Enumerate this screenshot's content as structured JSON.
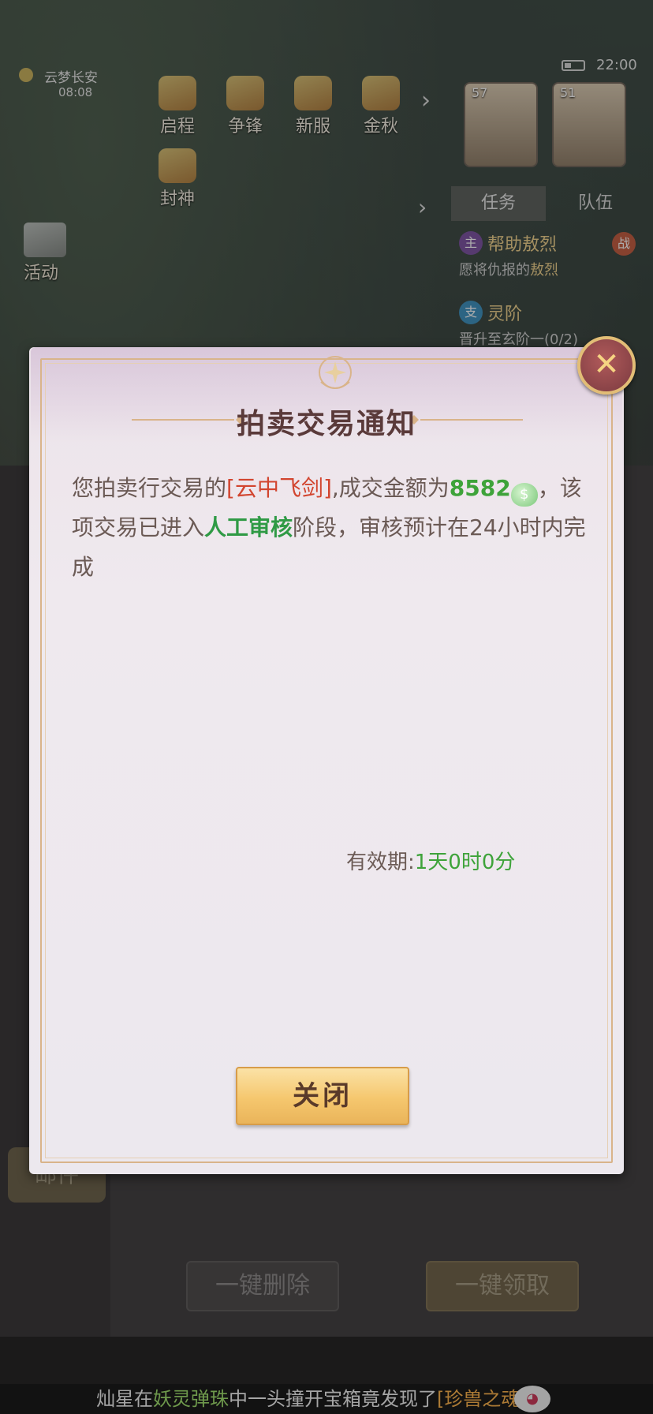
{
  "status_bar": {
    "time": "22:00"
  },
  "location": {
    "name": "云梦长安",
    "time": "08:08"
  },
  "top_menu": [
    {
      "label": "启程",
      "icon": "scroll-icon"
    },
    {
      "label": "争锋",
      "icon": "banner-icon"
    },
    {
      "label": "新服",
      "icon": "firework-icon"
    },
    {
      "label": "金秋",
      "icon": "character-icon"
    }
  ],
  "feng_shen": {
    "label": "封神"
  },
  "side_menu": {
    "activity": "活动"
  },
  "portraits": [
    {
      "level": "57"
    },
    {
      "level": "51"
    }
  ],
  "tracker": {
    "tab_task": "任务",
    "tab_team": "队伍",
    "quests": [
      {
        "tag": "主",
        "title": "帮助敖烈",
        "desc_prefix": "愿将仇报的",
        "desc_highlight": "敖烈",
        "badge": "战"
      },
      {
        "tag": "支",
        "title": "灵阶",
        "desc": "晋升至玄阶一(0/2)"
      }
    ]
  },
  "mail_panel": {
    "mail_button": "邮件",
    "delete_all": "一键删除",
    "claim_all": "一键领取"
  },
  "ticker": {
    "player": "灿星",
    "in": "在",
    "game": "妖灵弹珠",
    "mid": "中一头撞开宝箱竟发现了",
    "item": "[珍兽之魂]"
  },
  "dialog": {
    "title": "拍卖交易通知",
    "body_p1": "您拍卖行交易的",
    "item_name": "[云中飞剑]",
    "body_p2": ",成交金额为",
    "amount": "8582",
    "coin_glyph": "$",
    "body_p3": "，该项交易已进入",
    "review_stage": "人工审核",
    "body_p4": "阶段，审核预计在24小时内完成",
    "validity_label": "有效期:",
    "validity_value": "1天0时0分",
    "close_label": "关闭",
    "close_x": "✕"
  },
  "colors": {
    "accent_gold": "#f5c76e",
    "item_red": "#d2452f",
    "value_green": "#3ea33a"
  }
}
